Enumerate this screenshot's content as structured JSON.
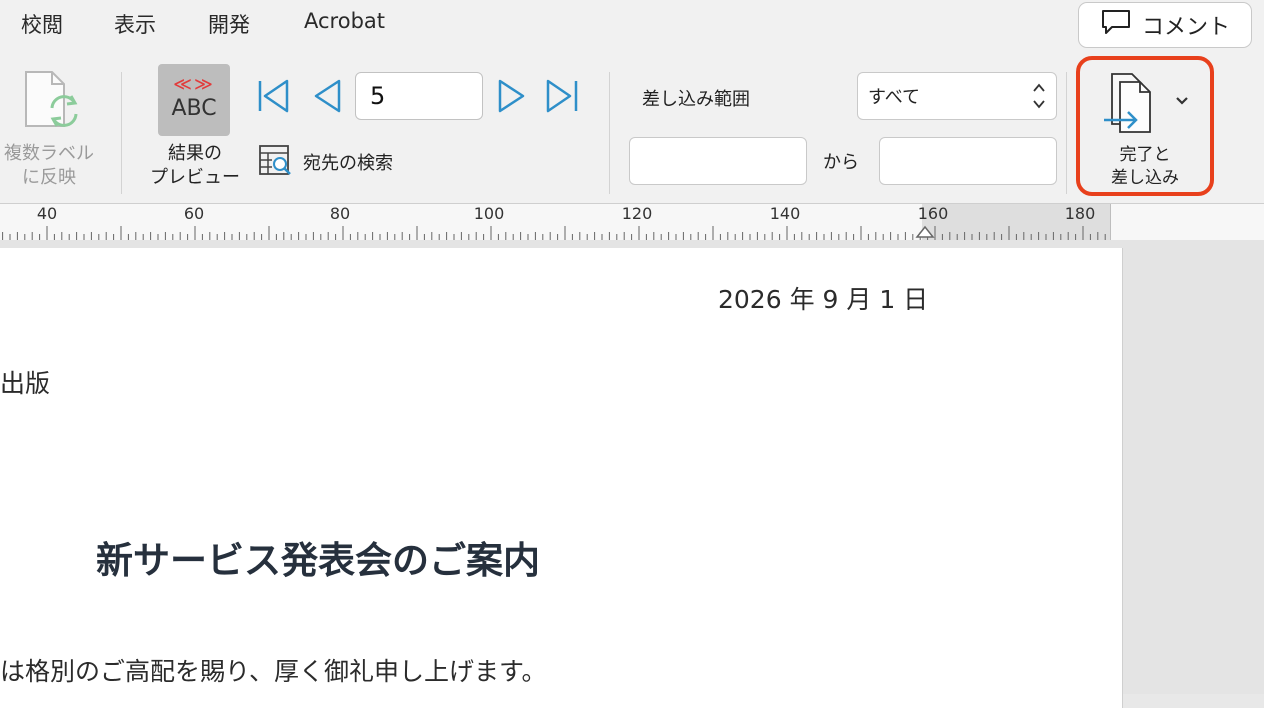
{
  "menu": {
    "tabs": [
      "校閲",
      "表示",
      "開発",
      "Acrobat"
    ],
    "comment_label": "コメント"
  },
  "ribbon": {
    "multi_label": {
      "line1": "複数ラベル",
      "line2": "に反映"
    },
    "preview": {
      "arrows": "≪≫",
      "abc": "ABC",
      "line1": "結果の",
      "line2": "プレビュー"
    },
    "record_number": "5",
    "find_recipient": "宛先の検索",
    "range_label": "差し込み範囲",
    "range_value": "すべて",
    "from_label": "から",
    "from_value": "",
    "to_value": "",
    "finish": {
      "line1": "完了と",
      "line2": "差し込み"
    }
  },
  "ruler": {
    "labels": [
      "40",
      "60",
      "80",
      "100",
      "120",
      "140",
      "160",
      "180"
    ]
  },
  "document": {
    "date": "2026 年 9 月 1 日",
    "org_fragment": "出版",
    "title": "新サービス発表会のご案内",
    "body_fragment": "は格別のご高配を賜り、厚く御礼申し上げます。"
  },
  "colors": {
    "highlight": "#e8401c",
    "nav_icon": "#2e8fc9",
    "preview_arrows": "#e23b3b",
    "title_text": "#26303d"
  }
}
